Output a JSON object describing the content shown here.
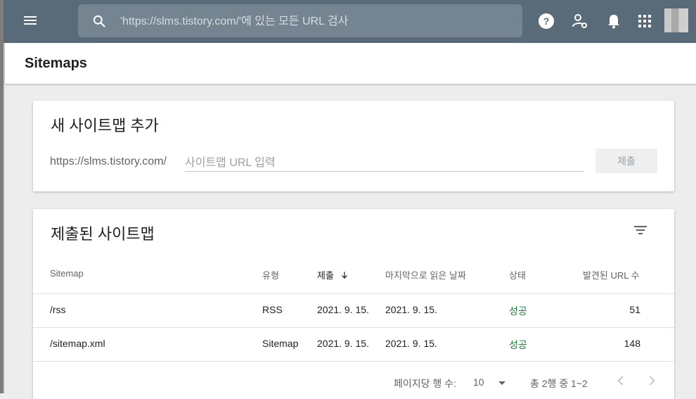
{
  "topbar": {
    "search_placeholder": "'https://slms.tistory.com/'에 있는 모든 URL 검사"
  },
  "page": {
    "title": "Sitemaps"
  },
  "add_card": {
    "title": "새 사이트맵 추가",
    "prefix": "https://slms.tistory.com/",
    "input_placeholder": "사이트맵 URL 입력",
    "submit_label": "제출"
  },
  "list_card": {
    "title": "제출된 사이트맵",
    "columns": [
      "Sitemap",
      "유형",
      "제출",
      "마지막으로 읽은 날짜",
      "상태",
      "발견된 URL 수"
    ],
    "rows": [
      [
        "/rss",
        "RSS",
        "2021. 9. 15.",
        "2021. 9. 15.",
        "성공",
        "51"
      ],
      [
        "/sitemap.xml",
        "Sitemap",
        "2021. 9. 15.",
        "2021. 9. 15.",
        "성공",
        "148"
      ]
    ],
    "pager": {
      "rows_label": "페이지당 행 수:",
      "rows_value": "10",
      "range": "총 2행 중 1~2"
    }
  },
  "colors": {
    "topbar": "#596b78",
    "status_success": "#188038"
  },
  "icons": [
    "menu-icon",
    "search-icon",
    "help-icon",
    "manage-users-icon",
    "notifications-icon",
    "apps-icon",
    "filter-icon",
    "arrow-down-icon",
    "chevron-left-icon",
    "chevron-right-icon"
  ]
}
